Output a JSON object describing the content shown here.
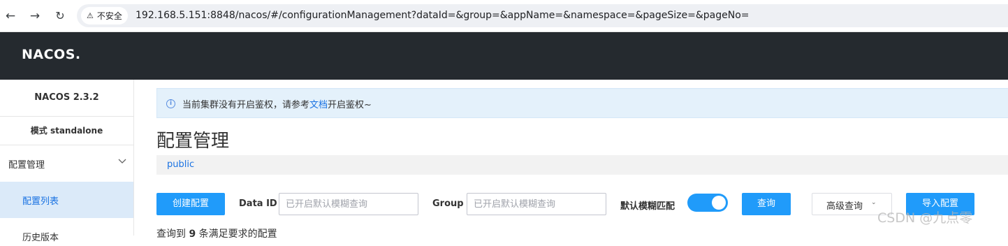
{
  "browser": {
    "security_label": "不安全",
    "url": "192.168.5.151:8848/nacos/#/configurationManagement?dataId=&group=&appName=&namespace=&pageSize=&pageNo="
  },
  "header": {
    "logo_text": "NACOS."
  },
  "sidebar": {
    "version": "NACOS 2.3.2",
    "mode": "模式 standalone",
    "group_label": "配置管理",
    "items": [
      {
        "label": "配置列表",
        "active": true
      },
      {
        "label": "历史版本",
        "active": false
      }
    ]
  },
  "notice": {
    "text_before": "当前集群没有开启鉴权，请参考",
    "link_text": "文档",
    "text_after": "开启鉴权~"
  },
  "page": {
    "title": "配置管理",
    "namespace": "public"
  },
  "toolbar": {
    "create_label": "创建配置",
    "dataid_label": "Data ID",
    "dataid_placeholder": "已开启默认模糊查询",
    "group_label": "Group",
    "group_placeholder": "已开启默认模糊查询",
    "fuzzy_label": "默认模糊匹配",
    "fuzzy_enabled": true,
    "query_label": "查询",
    "advanced_label": "高级查询",
    "import_label": "导入配置"
  },
  "result": {
    "prefix": "查询到",
    "count": "9",
    "suffix": "条满足要求的配置"
  },
  "watermark": "CSDN @九点零",
  "colors": {
    "primary": "#209bfa",
    "topbar": "#252a2f",
    "link": "#1b73e2"
  }
}
